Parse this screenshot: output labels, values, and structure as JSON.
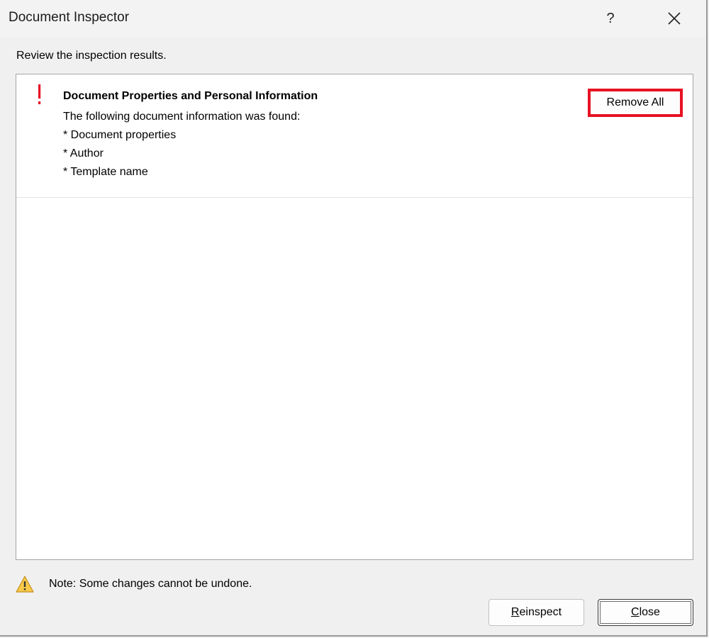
{
  "window": {
    "title": "Document Inspector",
    "help_label": "?",
    "close_icon": "close-icon"
  },
  "subtitle": "Review the inspection results.",
  "results": [
    {
      "status_icon": "exclamation-icon",
      "status_color": "#e81123",
      "title": "Document Properties and Personal Information",
      "lines": [
        "The following document information was found:",
        "* Document properties",
        "* Author",
        "* Template name"
      ],
      "action_label": "Remove All",
      "action_highlight_color": "#e81123"
    }
  ],
  "note": {
    "icon": "warning-icon",
    "text": "Note: Some changes cannot be undone."
  },
  "buttons": {
    "reinspect": {
      "accel": "R",
      "rest": "einspect"
    },
    "close": {
      "accel": "C",
      "rest": "lose"
    }
  }
}
